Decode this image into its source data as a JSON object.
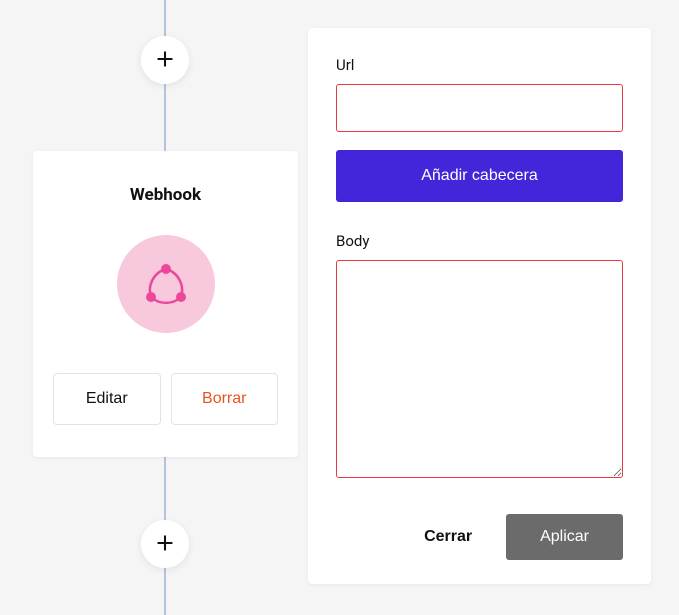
{
  "card": {
    "title": "Webhook",
    "edit_label": "Editar",
    "delete_label": "Borrar"
  },
  "panel": {
    "url_label": "Url",
    "url_value": "",
    "add_header_label": "Añadir cabecera",
    "body_label": "Body",
    "body_value": "",
    "close_label": "Cerrar",
    "apply_label": "Aplicar"
  },
  "colors": {
    "accent": "#4326d9",
    "danger": "#e63946",
    "delete_text": "#e8531f",
    "icon_bg": "#f8c8dc",
    "icon_fg": "#ec4899"
  }
}
